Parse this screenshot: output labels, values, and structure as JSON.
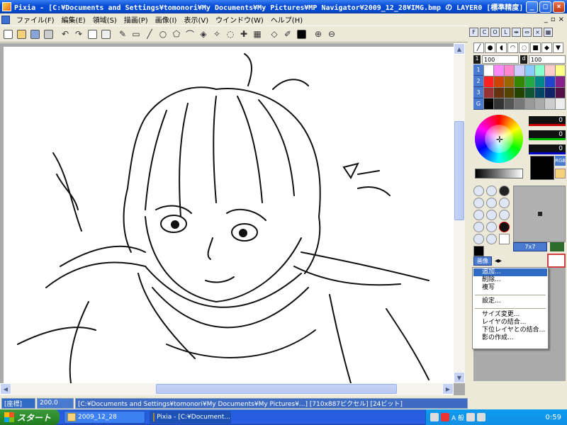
{
  "window": {
    "title": "Pixia - [C:¥Documents and Settings¥tomonori¥My Documents¥My Pictures¥MP Navigator¥2009_12_28¥IMG.bmp の LAYER0 [標準精度]]",
    "controls": {
      "minimize": "_",
      "maximize": "□",
      "close": "×"
    }
  },
  "menubar": {
    "items": [
      "ファイル(F)",
      "編集(E)",
      "領域(S)",
      "描画(P)",
      "画像(I)",
      "表示(V)",
      "ウインドウ(W)",
      "ヘルプ(H)"
    ],
    "mdi": {
      "minimize": "_",
      "restore": "▫",
      "close": "×"
    }
  },
  "toolbar": {
    "icons": [
      "new-file",
      "open-folder",
      "save",
      "print",
      "undo",
      "redo",
      "copy",
      "paste",
      "pen",
      "rectangle",
      "line",
      "circle",
      "polygon",
      "curve",
      "fill",
      "magic-wand",
      "lasso",
      "color-picker",
      "grid",
      "eraser",
      "brush-tool",
      "color-box",
      "zoom-in",
      "zoom-out"
    ]
  },
  "statusbar": {
    "coord_label": "[座標]",
    "zoom": "200.0",
    "path": "[C:¥Documents and Settings¥tomonori¥My Documents¥My Pictures¥...] [710x887ピクセル] [24ビット]"
  },
  "right_panel": {
    "tabs": [
      "F",
      "C",
      "O",
      "L"
    ],
    "values": {
      "a_label": "1",
      "a_value": "100",
      "b_label": "d",
      "b_value": "100"
    },
    "palette_tabs": [
      "1",
      "2",
      "3",
      "G"
    ],
    "palette": [
      "#ffffff",
      "#ff88ff",
      "#ff88cc",
      "#ccccff",
      "#88ccff",
      "#88ffcc",
      "#ffcccc",
      "#ffff88",
      "#ff2222",
      "#cc4400",
      "#996600",
      "#338800",
      "#22aa44",
      "#008888",
      "#2244cc",
      "#882288",
      "#993333",
      "#663311",
      "#554400",
      "#224400",
      "#115533",
      "#004466",
      "#112266",
      "#551144",
      "#000000",
      "#333333",
      "#555555",
      "#777777",
      "#999999",
      "#aaaaaa",
      "#cccccc",
      "#eeeeee"
    ],
    "rgb": {
      "r": "0",
      "g": "0",
      "b": "0"
    },
    "rgb_button": "RGB",
    "brush_size": "7x7",
    "layer_label": "画像"
  },
  "context_menu": {
    "items": [
      "追加...",
      "削除...",
      "複写",
      "設定...",
      "サイズ変更...",
      "レイヤの結合...",
      "下位レイヤとの結合...",
      "影の作成..."
    ]
  },
  "taskbar": {
    "start": "スタート",
    "tasks": [
      "2009_12_28",
      "Pixia - [C:¥Document..."
    ],
    "clock": "0:59",
    "ime": "A 般"
  }
}
